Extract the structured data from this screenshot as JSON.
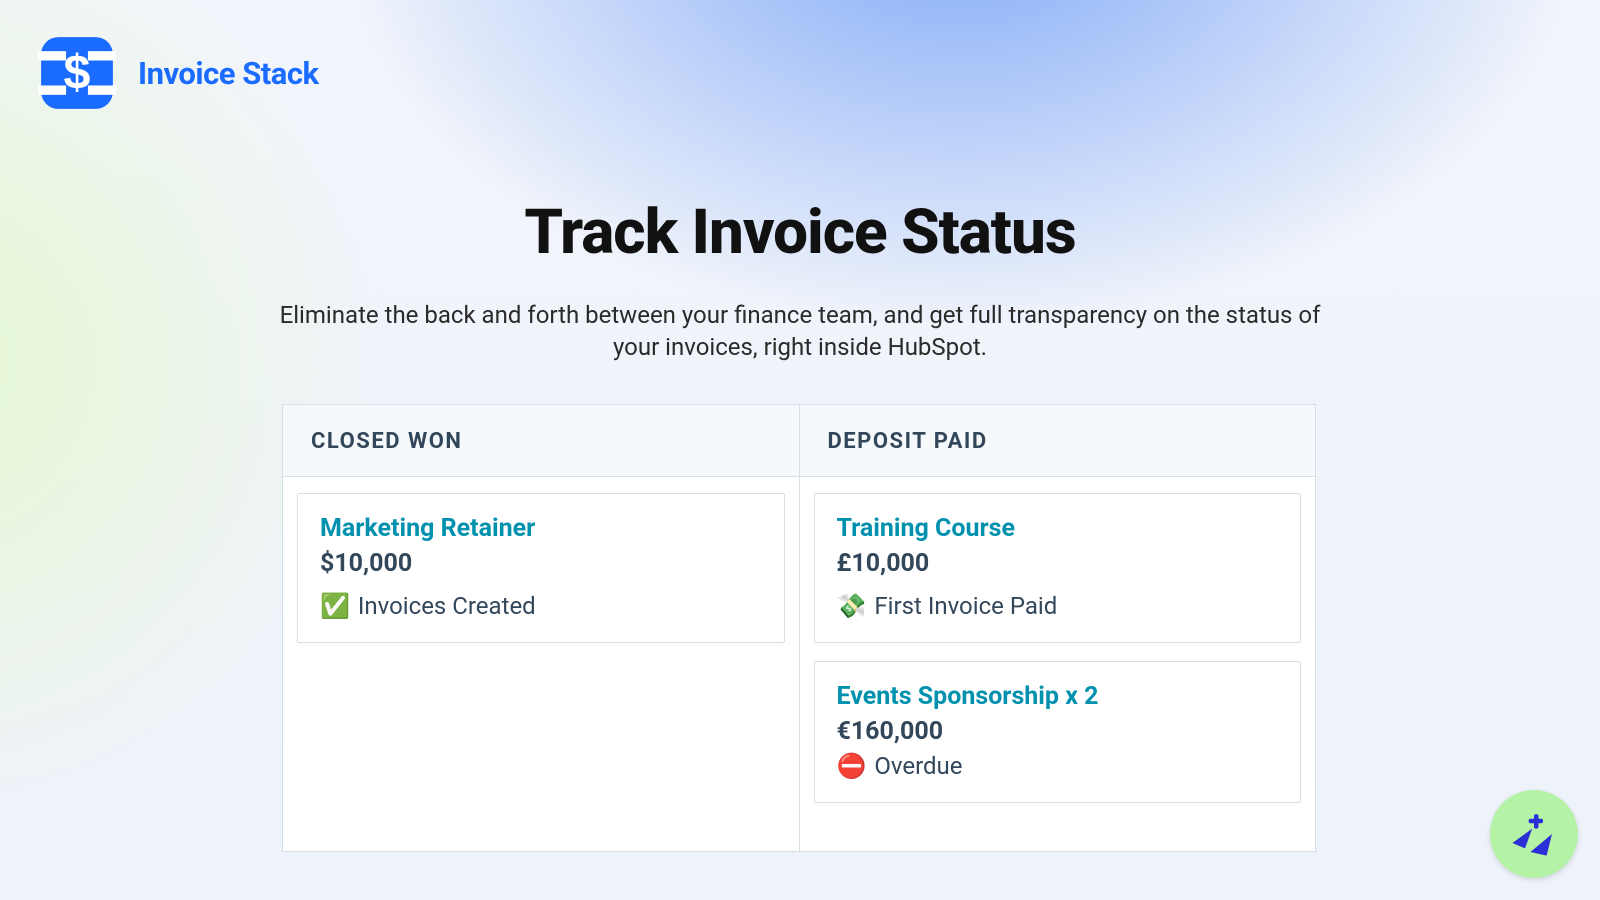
{
  "brand": {
    "name": "Invoice Stack"
  },
  "hero": {
    "title": "Track Invoice Status",
    "subtitle": "Eliminate the back and forth between your finance team, and get full transparency on the status of your invoices, right inside HubSpot."
  },
  "board": {
    "columns": [
      {
        "title": "CLOSED WON",
        "cards": [
          {
            "title": "Marketing Retainer",
            "amount": "$10,000",
            "status_icon": "✅",
            "status_text": "Invoices Created"
          }
        ]
      },
      {
        "title": "DEPOSIT PAID",
        "cards": [
          {
            "title": "Training Course",
            "amount": "£10,000",
            "status_icon": "💸",
            "status_text": "First Invoice Paid"
          },
          {
            "title": "Events Sponsorship x 2",
            "amount": "€160,000",
            "status_icon": "⛔",
            "status_text": "Overdue"
          }
        ]
      }
    ]
  }
}
